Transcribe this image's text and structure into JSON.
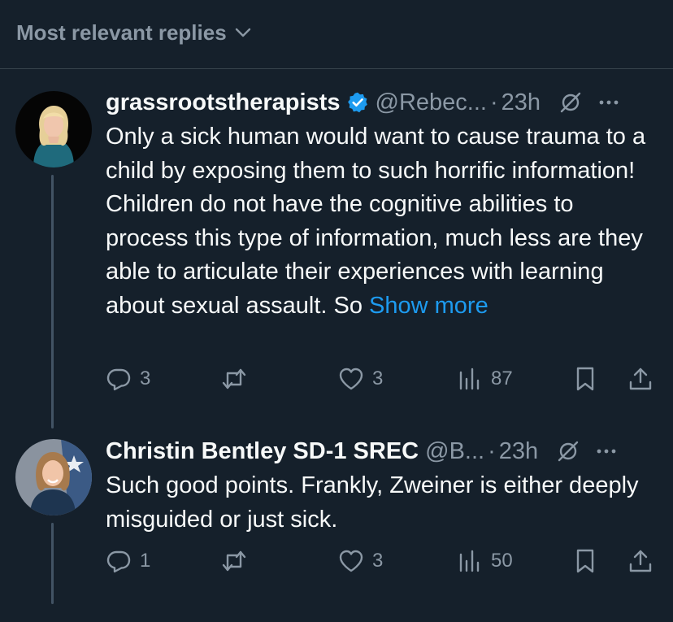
{
  "sort": {
    "label": "Most relevant replies"
  },
  "replies": [
    {
      "name": "grassrootstherapists",
      "verified": true,
      "handle": "@Rebec...",
      "separator": "·",
      "time": "23h",
      "text": "Only a sick human would want to cause trauma to a child by exposing them to such horrific information! Children do not have the cognitive abilities to process this type of information, much less are they able to articulate their experiences with learning about sexual assault. So",
      "show_more": "Show more",
      "stats": {
        "replies": "3",
        "reposts": "",
        "likes": "3",
        "views": "87"
      }
    },
    {
      "name": "Christin Bentley SD-1 SREC",
      "verified": false,
      "handle": "@B...",
      "separator": "·",
      "time": "23h",
      "text": "Such good points. Frankly, Zweiner is either deeply misguided or just sick.",
      "show_more": "",
      "stats": {
        "replies": "1",
        "reposts": "",
        "likes": "3",
        "views": "50"
      }
    }
  ],
  "icons": {
    "sort": "chevron-down-icon",
    "verified": "verified-badge-icon",
    "grok": "grok-icon",
    "more": "more-icon",
    "reply": "reply-icon",
    "repost": "repost-icon",
    "like": "heart-icon",
    "views": "views-icon",
    "bookmark": "bookmark-icon",
    "share": "share-icon"
  },
  "colors": {
    "background": "#15202b",
    "text": "#f7f9f9",
    "muted": "#8b98a5",
    "accent": "#1d9bf0",
    "divider": "#38444d"
  }
}
